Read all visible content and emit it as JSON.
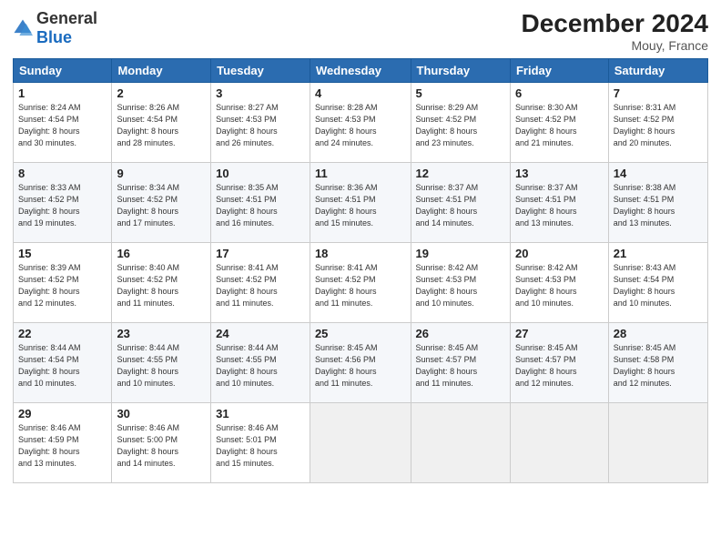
{
  "logo": {
    "general": "General",
    "blue": "Blue"
  },
  "title": "December 2024",
  "subtitle": "Mouy, France",
  "days_header": [
    "Sunday",
    "Monday",
    "Tuesday",
    "Wednesday",
    "Thursday",
    "Friday",
    "Saturday"
  ],
  "weeks": [
    [
      {
        "day": "1",
        "info": "Sunrise: 8:24 AM\nSunset: 4:54 PM\nDaylight: 8 hours\nand 30 minutes."
      },
      {
        "day": "2",
        "info": "Sunrise: 8:26 AM\nSunset: 4:54 PM\nDaylight: 8 hours\nand 28 minutes."
      },
      {
        "day": "3",
        "info": "Sunrise: 8:27 AM\nSunset: 4:53 PM\nDaylight: 8 hours\nand 26 minutes."
      },
      {
        "day": "4",
        "info": "Sunrise: 8:28 AM\nSunset: 4:53 PM\nDaylight: 8 hours\nand 24 minutes."
      },
      {
        "day": "5",
        "info": "Sunrise: 8:29 AM\nSunset: 4:52 PM\nDaylight: 8 hours\nand 23 minutes."
      },
      {
        "day": "6",
        "info": "Sunrise: 8:30 AM\nSunset: 4:52 PM\nDaylight: 8 hours\nand 21 minutes."
      },
      {
        "day": "7",
        "info": "Sunrise: 8:31 AM\nSunset: 4:52 PM\nDaylight: 8 hours\nand 20 minutes."
      }
    ],
    [
      {
        "day": "8",
        "info": "Sunrise: 8:33 AM\nSunset: 4:52 PM\nDaylight: 8 hours\nand 19 minutes."
      },
      {
        "day": "9",
        "info": "Sunrise: 8:34 AM\nSunset: 4:52 PM\nDaylight: 8 hours\nand 17 minutes."
      },
      {
        "day": "10",
        "info": "Sunrise: 8:35 AM\nSunset: 4:51 PM\nDaylight: 8 hours\nand 16 minutes."
      },
      {
        "day": "11",
        "info": "Sunrise: 8:36 AM\nSunset: 4:51 PM\nDaylight: 8 hours\nand 15 minutes."
      },
      {
        "day": "12",
        "info": "Sunrise: 8:37 AM\nSunset: 4:51 PM\nDaylight: 8 hours\nand 14 minutes."
      },
      {
        "day": "13",
        "info": "Sunrise: 8:37 AM\nSunset: 4:51 PM\nDaylight: 8 hours\nand 13 minutes."
      },
      {
        "day": "14",
        "info": "Sunrise: 8:38 AM\nSunset: 4:51 PM\nDaylight: 8 hours\nand 13 minutes."
      }
    ],
    [
      {
        "day": "15",
        "info": "Sunrise: 8:39 AM\nSunset: 4:52 PM\nDaylight: 8 hours\nand 12 minutes."
      },
      {
        "day": "16",
        "info": "Sunrise: 8:40 AM\nSunset: 4:52 PM\nDaylight: 8 hours\nand 11 minutes."
      },
      {
        "day": "17",
        "info": "Sunrise: 8:41 AM\nSunset: 4:52 PM\nDaylight: 8 hours\nand 11 minutes."
      },
      {
        "day": "18",
        "info": "Sunrise: 8:41 AM\nSunset: 4:52 PM\nDaylight: 8 hours\nand 11 minutes."
      },
      {
        "day": "19",
        "info": "Sunrise: 8:42 AM\nSunset: 4:53 PM\nDaylight: 8 hours\nand 10 minutes."
      },
      {
        "day": "20",
        "info": "Sunrise: 8:42 AM\nSunset: 4:53 PM\nDaylight: 8 hours\nand 10 minutes."
      },
      {
        "day": "21",
        "info": "Sunrise: 8:43 AM\nSunset: 4:54 PM\nDaylight: 8 hours\nand 10 minutes."
      }
    ],
    [
      {
        "day": "22",
        "info": "Sunrise: 8:44 AM\nSunset: 4:54 PM\nDaylight: 8 hours\nand 10 minutes."
      },
      {
        "day": "23",
        "info": "Sunrise: 8:44 AM\nSunset: 4:55 PM\nDaylight: 8 hours\nand 10 minutes."
      },
      {
        "day": "24",
        "info": "Sunrise: 8:44 AM\nSunset: 4:55 PM\nDaylight: 8 hours\nand 10 minutes."
      },
      {
        "day": "25",
        "info": "Sunrise: 8:45 AM\nSunset: 4:56 PM\nDaylight: 8 hours\nand 11 minutes."
      },
      {
        "day": "26",
        "info": "Sunrise: 8:45 AM\nSunset: 4:57 PM\nDaylight: 8 hours\nand 11 minutes."
      },
      {
        "day": "27",
        "info": "Sunrise: 8:45 AM\nSunset: 4:57 PM\nDaylight: 8 hours\nand 12 minutes."
      },
      {
        "day": "28",
        "info": "Sunrise: 8:45 AM\nSunset: 4:58 PM\nDaylight: 8 hours\nand 12 minutes."
      }
    ],
    [
      {
        "day": "29",
        "info": "Sunrise: 8:46 AM\nSunset: 4:59 PM\nDaylight: 8 hours\nand 13 minutes."
      },
      {
        "day": "30",
        "info": "Sunrise: 8:46 AM\nSunset: 5:00 PM\nDaylight: 8 hours\nand 14 minutes."
      },
      {
        "day": "31",
        "info": "Sunrise: 8:46 AM\nSunset: 5:01 PM\nDaylight: 8 hours\nand 15 minutes."
      },
      null,
      null,
      null,
      null
    ]
  ]
}
